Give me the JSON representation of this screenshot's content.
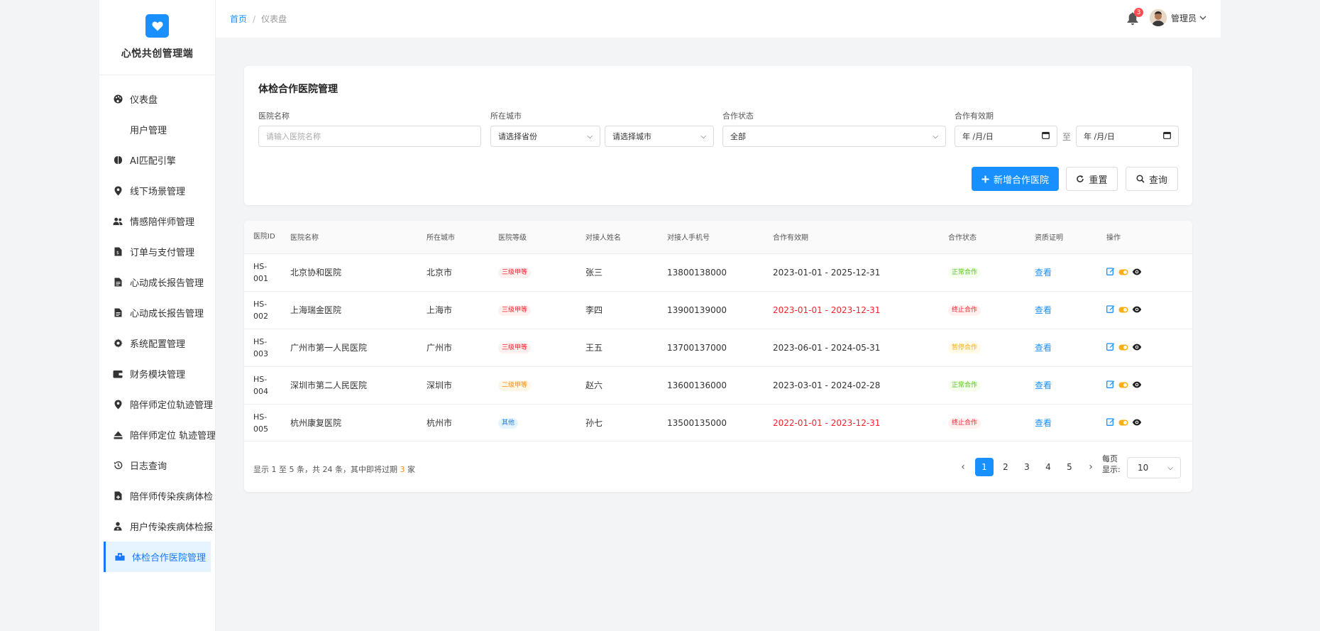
{
  "app": {
    "title": "心悦共创管理端"
  },
  "sidebar": {
    "items": [
      {
        "label": "仪表盘",
        "icon": "palette-icon"
      },
      {
        "label": "用户管理",
        "icon": ""
      },
      {
        "label": "AI匹配引擎",
        "icon": "brain-icon"
      },
      {
        "label": "线下场景管理",
        "icon": "map-pin-icon"
      },
      {
        "label": "情感陪伴师管理",
        "icon": "users-icon"
      },
      {
        "label": "订单与支付管理",
        "icon": "invoice-icon"
      },
      {
        "label": "心动成长报告管理",
        "icon": "document-icon"
      },
      {
        "label": "心动成长报告管理",
        "icon": "document-icon"
      },
      {
        "label": "系统配置管理",
        "icon": "gear-icon"
      },
      {
        "label": "财务模块管理",
        "icon": "wallet-icon"
      },
      {
        "label": "陪伴师定位轨迹管理",
        "icon": "map-pin-icon"
      },
      {
        "label": "陪伴师定位 轨迹管理",
        "icon": "eject-icon"
      },
      {
        "label": "日志查询",
        "icon": "history-icon"
      },
      {
        "label": "陪伴师传染疾病体检",
        "icon": "medical-file-icon"
      },
      {
        "label": "用户传染疾病体检报",
        "icon": "user-doctor-icon"
      },
      {
        "label": "体检合作医院管理",
        "icon": "hospital-icon"
      }
    ]
  },
  "header": {
    "breadcrumb_home": "首页",
    "breadcrumb_sep": "/",
    "breadcrumb_current": "仪表盘",
    "notification_count": "3",
    "user_name": "管理员"
  },
  "filter": {
    "title": "体检合作医院管理",
    "hospital_name_label": "医院名称",
    "hospital_name_placeholder": "请输入医院名称",
    "city_label": "所在城市",
    "province_select": "请选择省份",
    "city_select": "请选择城市",
    "status_label": "合作状态",
    "status_select": "全部",
    "validity_label": "合作有效期",
    "date_start": "年 /月/日",
    "date_to": "至",
    "date_end": "年 /月/日",
    "add_button": "新增合作医院",
    "reset_button": "重置",
    "search_button": "查询"
  },
  "table": {
    "headers": [
      "医院ID",
      "医院名称",
      "所在城市",
      "医院等级",
      "对接人姓名",
      "对接人手机号",
      "合作有效期",
      "合作状态",
      "资质证明",
      "操作"
    ],
    "rows": [
      {
        "id": "HS-001",
        "name": "北京协和医院",
        "city": "北京市",
        "level": "三级甲等",
        "level_style": "red",
        "contact": "张三",
        "phone": "13800138000",
        "period": "2023-01-01 - 2025-12-31",
        "period_expired": false,
        "status": "正常合作",
        "status_style": "green",
        "cert": "查看"
      },
      {
        "id": "HS-002",
        "name": "上海瑞金医院",
        "city": "上海市",
        "level": "三级甲等",
        "level_style": "red",
        "contact": "李四",
        "phone": "13900139000",
        "period": "2023-01-01 - 2023-12-31",
        "period_expired": true,
        "status": "终止合作",
        "status_style": "red",
        "cert": "查看"
      },
      {
        "id": "HS-003",
        "name": "广州市第一人民医院",
        "city": "广州市",
        "level": "三级甲等",
        "level_style": "red",
        "contact": "王五",
        "phone": "13700137000",
        "period": "2023-06-01 - 2024-05-31",
        "period_expired": false,
        "status": "暂停合作",
        "status_style": "gold",
        "cert": "查看"
      },
      {
        "id": "HS-004",
        "name": "深圳市第二人民医院",
        "city": "深圳市",
        "level": "二级甲等",
        "level_style": "orange",
        "contact": "赵六",
        "phone": "13600136000",
        "period": "2023-03-01 - 2024-02-28",
        "period_expired": false,
        "status": "正常合作",
        "status_style": "green",
        "cert": "查看"
      },
      {
        "id": "HS-005",
        "name": "杭州康复医院",
        "city": "杭州市",
        "level": "其他",
        "level_style": "blue",
        "contact": "孙七",
        "phone": "13500135000",
        "period": "2022-01-01 - 2023-12-31",
        "period_expired": true,
        "status": "终止合作",
        "status_style": "red",
        "cert": "查看"
      }
    ]
  },
  "pagination": {
    "info_prefix": "显示 1 至 5 条，共 24 条，其中即将过期 ",
    "expiring_count": "3",
    "info_suffix": " 家",
    "pages": [
      "1",
      "2",
      "3",
      "4",
      "5"
    ],
    "current_page": "1",
    "per_page_label": "每页显示:",
    "per_page_value": "10"
  },
  "colors": {
    "primary": "#1890ff",
    "danger": "#f5222d",
    "warning": "#fa8c16",
    "success": "#52c41a"
  }
}
